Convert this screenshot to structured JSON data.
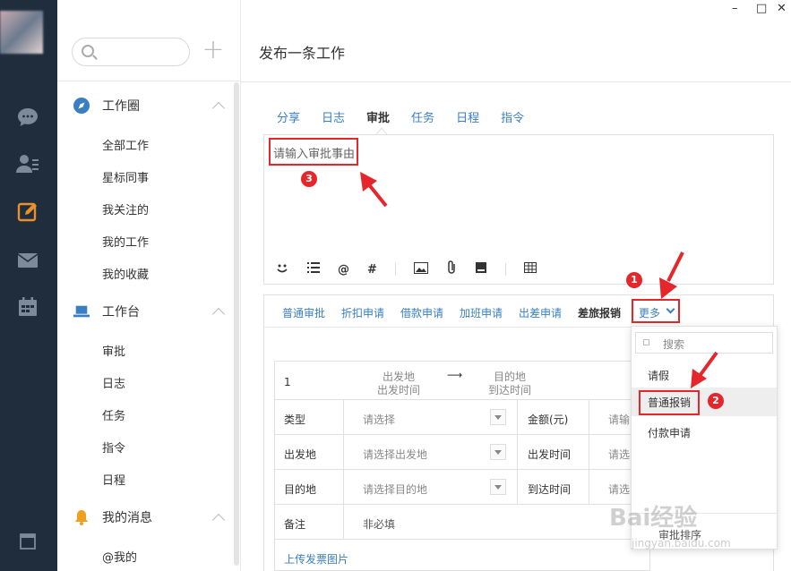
{
  "window": {
    "minimize": "–",
    "maximize": "□",
    "close": "✕"
  },
  "sidebar": {
    "search_placeholder": "",
    "sections": [
      {
        "title": "工作圈",
        "items": [
          "全部工作",
          "星标同事",
          "我关注的",
          "我的工作",
          "我的收藏"
        ]
      },
      {
        "title": "工作台",
        "items": [
          "审批",
          "日志",
          "任务",
          "指令",
          "日程"
        ]
      },
      {
        "title": "我的消息",
        "items": [
          "@我的"
        ]
      }
    ]
  },
  "header": {
    "title": "发布一条工作"
  },
  "composer": {
    "tabs": [
      "分享",
      "日志",
      "审批",
      "任务",
      "日程",
      "指令"
    ],
    "active_tab": "审批",
    "placeholder": "请输入审批事由"
  },
  "approval": {
    "tabs": [
      "普通审批",
      "折扣申请",
      "借款申请",
      "加班申请",
      "出差申请",
      "差旅报销"
    ],
    "active_tab": "差旅报销",
    "more_label": "更多",
    "trip": {
      "index": "1",
      "from_label": "出发地",
      "from_time_label": "出发时间",
      "arrow": "⟶",
      "to_label": "目的地",
      "to_time_label": "到达时间"
    },
    "rows": [
      {
        "label": "类型",
        "value": "请选择",
        "right_label": "金额(元)",
        "right_value": "请输"
      },
      {
        "label": "出发地",
        "value": "请选择出发地",
        "right_label": "出发时间",
        "right_value": "请选"
      },
      {
        "label": "目的地",
        "value": "请选择目的地",
        "right_label": "到达时间",
        "right_value": "请选"
      },
      {
        "label": "备注",
        "value": "非必填"
      }
    ],
    "upload_label": "上传发票图片"
  },
  "dropdown": {
    "search_placeholder": "搜索",
    "items": [
      "请假",
      "普通报销",
      "付款申请"
    ],
    "highlighted": "普通报销",
    "footer": "审批排序"
  },
  "annotations": [
    "1",
    "2",
    "3"
  ],
  "watermark": {
    "brand": "Bai经验",
    "url": "jingyan.baidu.com"
  },
  "colors": {
    "accent": "#3a7fc1",
    "annotation": "#e5262b",
    "rail": "#1f2d3d",
    "icon_blue": "#3a7fc1",
    "edit_icon": "#e8902a"
  }
}
